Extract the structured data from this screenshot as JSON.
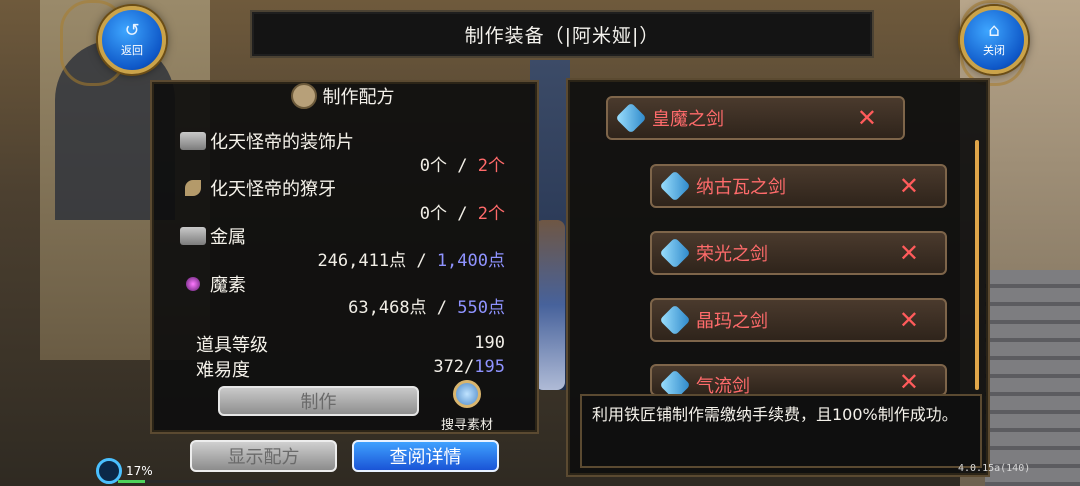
{
  "header": {
    "title": "制作装备（|阿米娅|）",
    "back_label": "返回",
    "close_label": "关闭"
  },
  "recipe": {
    "title": "制作配方",
    "materials": [
      {
        "name": "化天怪帝的装饰片",
        "have": "0个",
        "sep": " / ",
        "need": "2个",
        "need_color": "#ff6a6a"
      },
      {
        "name": "化天怪帝的獠牙",
        "have": "0个",
        "sep": " / ",
        "need": "2个",
        "need_color": "#ff6a6a"
      },
      {
        "name": "金属",
        "have": "246,411点",
        "sep": " / ",
        "need": "1,400点",
        "need_color": "#8f93ff"
      },
      {
        "name": "魔素",
        "have": "63,468点",
        "sep": " / ",
        "need": "550点",
        "need_color": "#8f93ff"
      }
    ],
    "item_level_label": "道具等级",
    "item_level_value": "190",
    "difficulty_label": "难易度",
    "difficulty_value_a": "372/",
    "difficulty_value_b": "195",
    "make_label": "制作",
    "search_label": "搜寻素材"
  },
  "bottom_buttons": {
    "show_recipe": "显示配方",
    "view_details": "查阅详情"
  },
  "weapons": [
    {
      "name": "皇魔之剑",
      "remove": "✕"
    },
    {
      "name": "纳古瓦之剑",
      "remove": "✕"
    },
    {
      "name": "荣光之剑",
      "remove": "✕"
    },
    {
      "name": "晶玛之剑",
      "remove": "✕"
    },
    {
      "name": "气流剑",
      "remove": "✕"
    }
  ],
  "description": "利用铁匠铺制作需缴纳手续费，且100%制作成功。",
  "status": {
    "progress_text": "17%",
    "progress_fraction": 0.17,
    "version": "4.0.15a(140)"
  },
  "colors": {
    "accent_blue": "#1a54d6",
    "weapon_red": "#ff6b6b",
    "panel_border": "#5b4a31"
  }
}
